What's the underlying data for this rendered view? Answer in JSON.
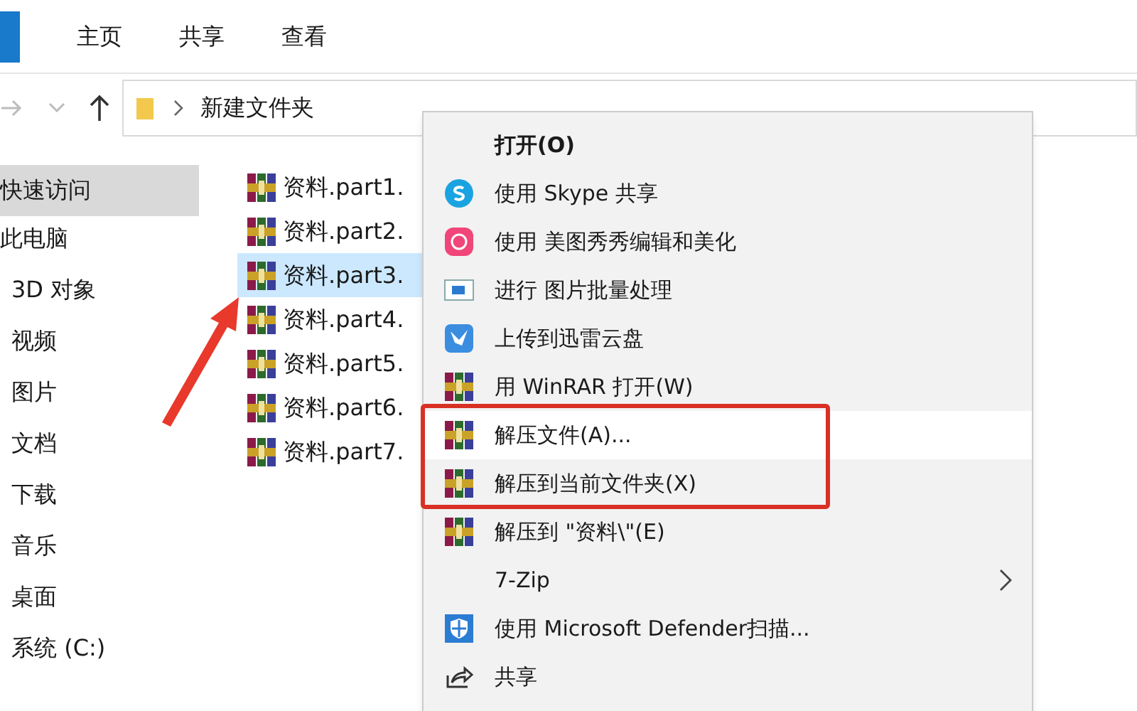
{
  "ribbon": {
    "tabs": [
      {
        "label": "主页",
        "selected": false
      },
      {
        "label": "共享",
        "selected": false
      },
      {
        "label": "查看",
        "selected": false
      }
    ]
  },
  "address_bar": {
    "path": [
      "新建文件夹"
    ]
  },
  "sidebar": {
    "items": [
      {
        "label": "快速访问",
        "selected": true
      },
      {
        "label": "此电脑",
        "selected": false
      },
      {
        "label": "3D 对象",
        "selected": false
      },
      {
        "label": "视频",
        "selected": false
      },
      {
        "label": "图片",
        "selected": false
      },
      {
        "label": "文档",
        "selected": false
      },
      {
        "label": "下载",
        "selected": false
      },
      {
        "label": "音乐",
        "selected": false
      },
      {
        "label": "桌面",
        "selected": false
      },
      {
        "label": "系统 (C:)",
        "selected": false
      }
    ]
  },
  "files": [
    {
      "name": "资料.part1.",
      "selected": false
    },
    {
      "name": "资料.part2.",
      "selected": false
    },
    {
      "name": "资料.part3.",
      "selected": true
    },
    {
      "name": "资料.part4.",
      "selected": false
    },
    {
      "name": "资料.part5.",
      "selected": false
    },
    {
      "name": "资料.part6.",
      "selected": false
    },
    {
      "name": "资料.part7.",
      "selected": false
    }
  ],
  "context_menu": {
    "items": [
      {
        "label": "打开(O)",
        "kind": "none",
        "default": true,
        "highlighted": false,
        "submenu": false
      },
      {
        "label": "使用 Skype 共享",
        "kind": "skype",
        "default": false,
        "highlighted": false,
        "submenu": false
      },
      {
        "label": "使用 美图秀秀编辑和美化",
        "kind": "meitu",
        "default": false,
        "highlighted": false,
        "submenu": false
      },
      {
        "label": "进行 图片批量处理",
        "kind": "image",
        "default": false,
        "highlighted": false,
        "submenu": false
      },
      {
        "label": "上传到迅雷云盘",
        "kind": "xunlei",
        "default": false,
        "highlighted": false,
        "submenu": false
      },
      {
        "label": "用 WinRAR 打开(W)",
        "kind": "winrar",
        "default": false,
        "highlighted": false,
        "submenu": false
      },
      {
        "label": "解压文件(A)...",
        "kind": "winrar",
        "default": false,
        "highlighted": true,
        "submenu": false
      },
      {
        "label": "解压到当前文件夹(X)",
        "kind": "winrar",
        "default": false,
        "highlighted": false,
        "submenu": false
      },
      {
        "label": "解压到 \"资料\\\"(E)",
        "kind": "winrar",
        "default": false,
        "highlighted": false,
        "submenu": false
      },
      {
        "label": "7-Zip",
        "kind": "none",
        "default": false,
        "highlighted": false,
        "submenu": true
      },
      {
        "label": "使用 Microsoft Defender扫描...",
        "kind": "defender",
        "default": false,
        "highlighted": false,
        "submenu": false
      },
      {
        "label": "共享",
        "kind": "share",
        "default": false,
        "highlighted": false,
        "submenu": false
      }
    ]
  }
}
